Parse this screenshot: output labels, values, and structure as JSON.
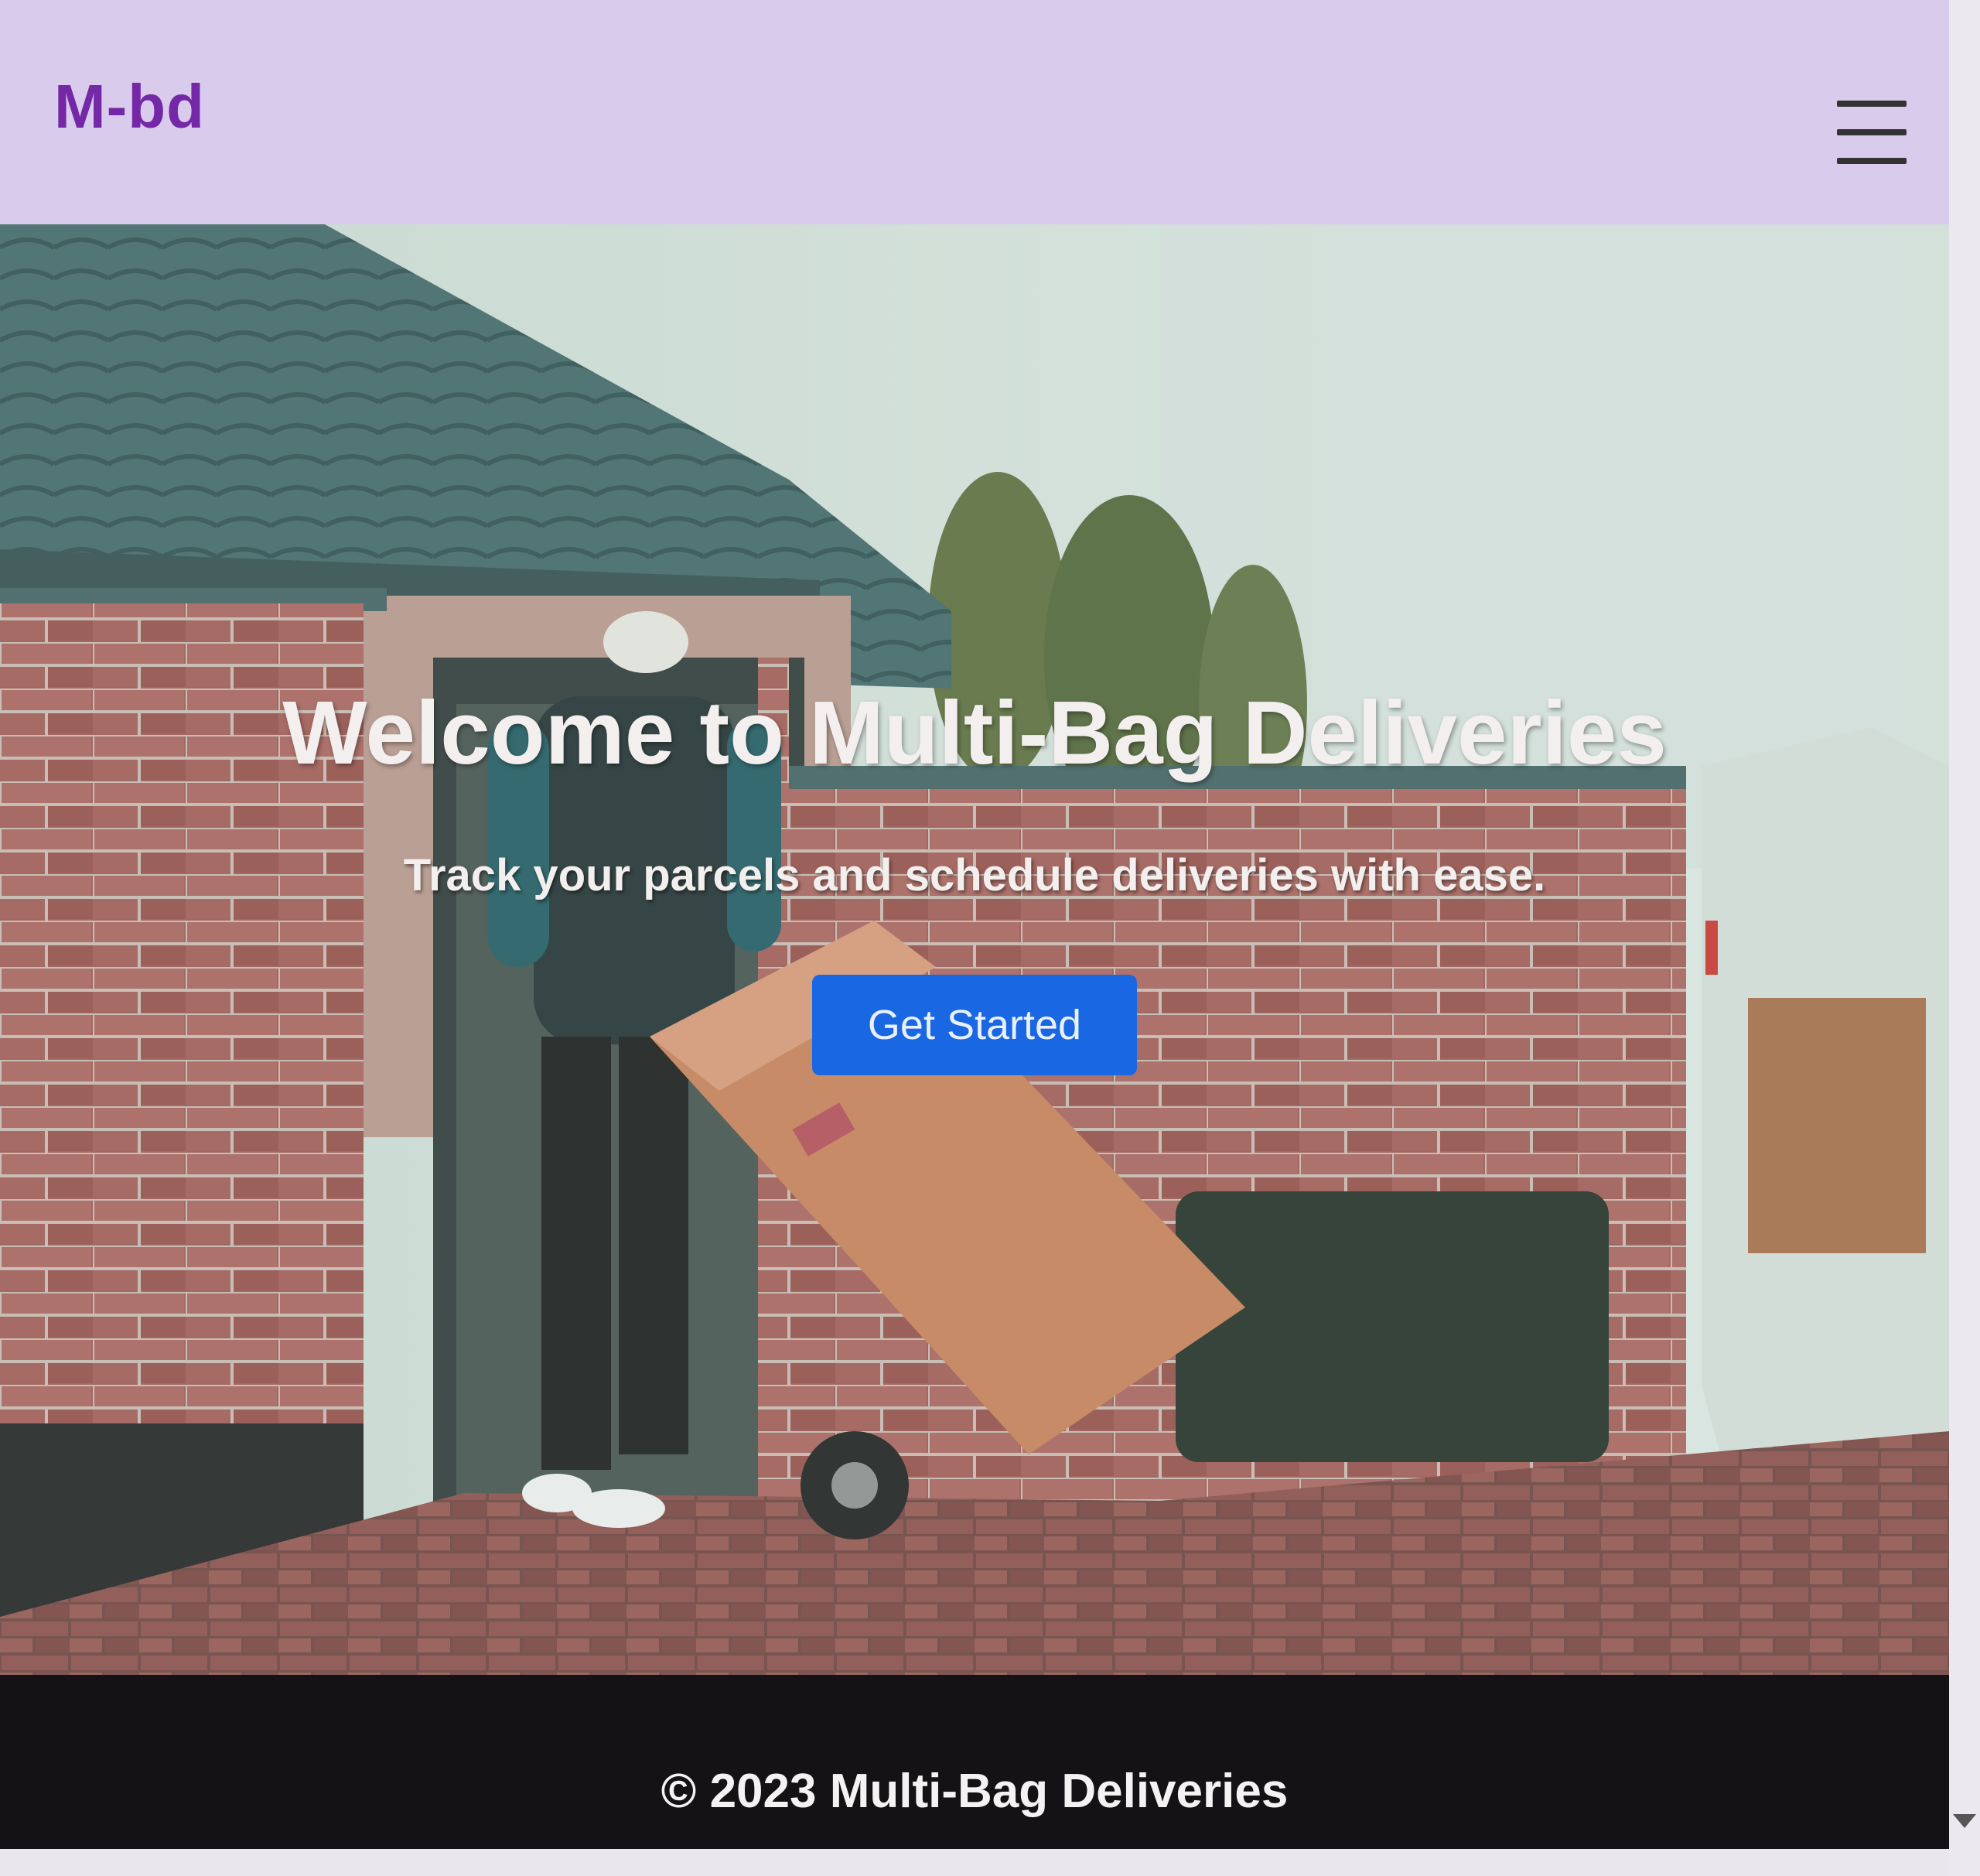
{
  "navbar": {
    "brand": "M-bd",
    "menu_icon": "hamburger-menu-icon"
  },
  "hero": {
    "title": "Welcome to Multi-Bag Deliveries",
    "subtitle": "Track your parcels and schedule deliveries with ease.",
    "cta_label": "Get Started",
    "background_image": "delivery-person-hand-truck-photo"
  },
  "footer": {
    "text": "© 2023 Multi-Bag Deliveries"
  },
  "colors": {
    "navbar_bg": "#d9cbec",
    "brand": "#7427a6",
    "cta_bg": "#1a67e3",
    "footer_bg": "#141214"
  }
}
